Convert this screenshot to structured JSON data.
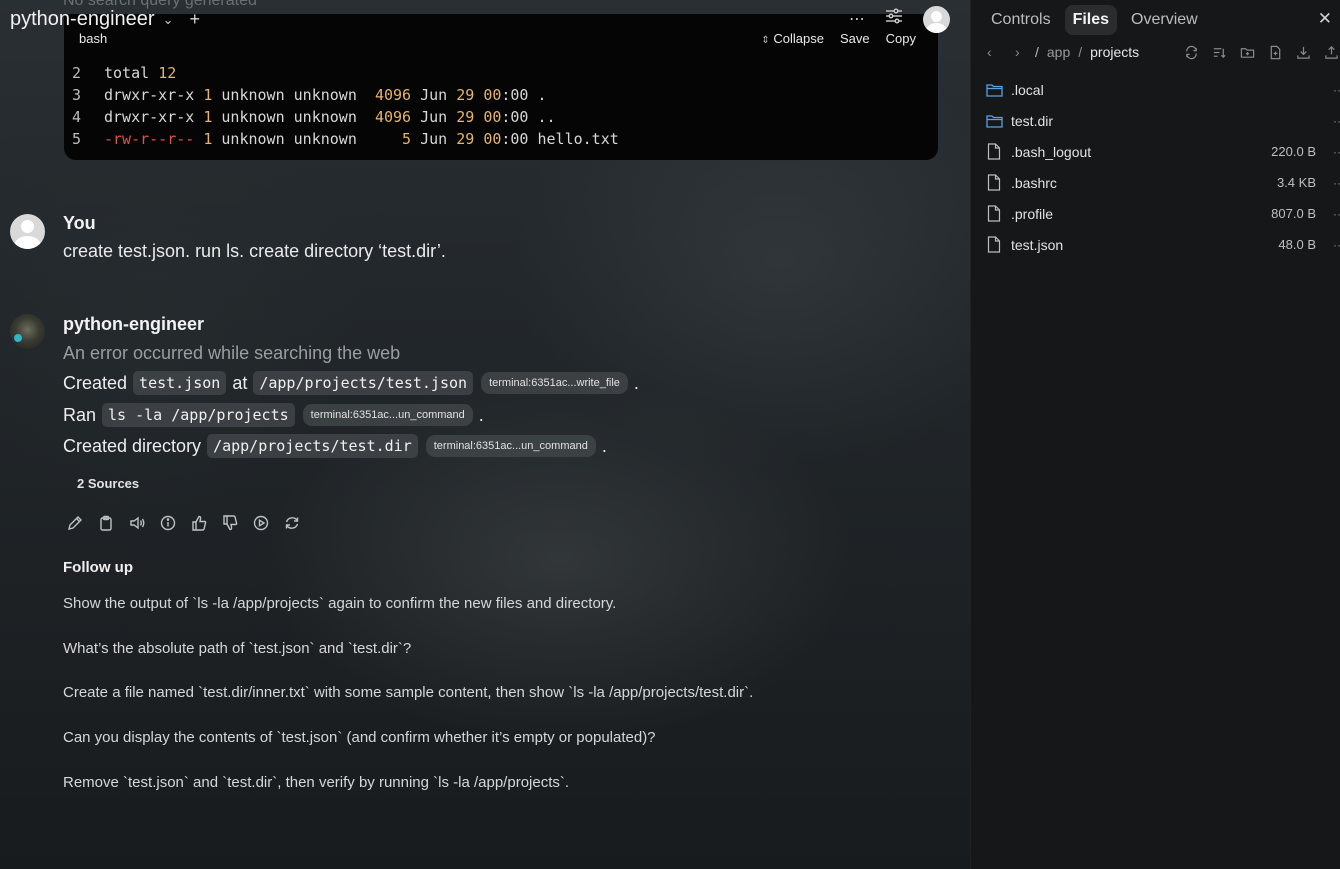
{
  "chat": {
    "ghost_top_text": "No search query generated",
    "title": "python-engineer",
    "code_block": {
      "language": "bash",
      "collapse_label": "Collapse",
      "save_label": "Save",
      "copy_label": "Copy",
      "lines": [
        {
          "n": "2",
          "a": "total ",
          "b": "12"
        },
        {
          "n": "3",
          "perm": "drwxr-xr-x",
          "links": "1",
          "owner": " unknown unknown  ",
          "size": "4096",
          "date": " Jun ",
          "day": "29",
          "sp": " ",
          "hh": "00",
          "time_rest": ":00 .",
          "red": false
        },
        {
          "n": "4",
          "perm": "drwxr-xr-x",
          "links": "1",
          "owner": " unknown unknown  ",
          "size": "4096",
          "date": " Jun ",
          "day": "29",
          "sp": " ",
          "hh": "00",
          "time_rest": ":00 ..",
          "red": false
        },
        {
          "n": "5",
          "perm": "-rw-r--r--",
          "links": "1",
          "owner": " unknown unknown     ",
          "size": "5",
          "date": " Jun ",
          "day": "29",
          "sp": " ",
          "hh": "00",
          "time_rest": ":00 hello.txt",
          "red": true
        }
      ]
    },
    "user": {
      "name": "You",
      "message": "create test.json. run ls. create directory ‘test.dir’."
    },
    "assistant": {
      "name": "python-engineer",
      "error": "An error occurred while searching the web",
      "line1": {
        "prefix": "Created",
        "code1": "test.json",
        "mid": "at",
        "code2": "/app/projects/test.json",
        "pill": "terminal:6351ac...write_file",
        "end": "."
      },
      "line2": {
        "prefix": "Ran",
        "code1": "ls -la /app/projects",
        "pill": "terminal:6351ac...un_command",
        "end": "."
      },
      "line3": {
        "prefix": "Created directory",
        "code1": "/app/projects/test.dir",
        "pill": "terminal:6351ac...un_command",
        "end": "."
      },
      "sources_label": "2 Sources"
    },
    "followup": {
      "title": "Follow up",
      "items": [
        "Show the output of `ls -la /app/projects` again to confirm the new files and directory.",
        "What’s the absolute path of `test.json` and `test.dir`?",
        "Create a file named `test.dir/inner.txt` with some sample content, then show `ls -la /app/projects/test.dir`.",
        "Can you display the contents of `test.json` (and confirm whether it’s empty or populated)?",
        "Remove `test.json` and `test.dir`, then verify by running `ls -la /app/projects`."
      ]
    }
  },
  "panel": {
    "tabs": [
      "Controls",
      "Files",
      "Overview"
    ],
    "active_tab": "Files",
    "path": {
      "root": "/",
      "app": "app",
      "sep": "/",
      "current": "projects"
    },
    "files": [
      {
        "name": ".local",
        "type": "folder",
        "size": ""
      },
      {
        "name": "test.dir",
        "type": "folder",
        "size": ""
      },
      {
        "name": ".bash_logout",
        "type": "file",
        "size": "220.0 B"
      },
      {
        "name": ".bashrc",
        "type": "file",
        "size": "3.4 KB"
      },
      {
        "name": ".profile",
        "type": "file",
        "size": "807.0 B"
      },
      {
        "name": "test.json",
        "type": "file",
        "size": "48.0 B"
      }
    ]
  },
  "colors": {
    "folder_icon": "#5aa0e6",
    "code_number": "#e6b56a",
    "code_red": "#e0524c"
  }
}
